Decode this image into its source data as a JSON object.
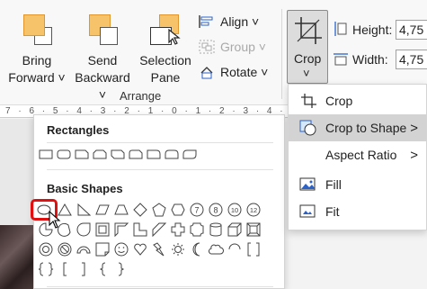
{
  "arrange": {
    "bring_forward": {
      "line1": "Bring",
      "line2": "Forward ˅"
    },
    "send_backward": {
      "line1": "Send",
      "line2": "Backward ˅"
    },
    "selection_pane": {
      "line1": "Selection",
      "line2": "Pane"
    },
    "align": "Align ˅",
    "group": "Group ˅",
    "rotate": "Rotate ˅",
    "group_label": "Arrange"
  },
  "crop_button": {
    "label": "Crop",
    "chevron": "˅"
  },
  "size": {
    "height_label": "Height:",
    "height_value": "4,75",
    "width_label": "Width:",
    "width_value": "4,75"
  },
  "ruler": {
    "text": "7 · 6 · 5 · 4 · 3 · 2 · 1 · 0 · 1 · 2 · 3 · 4 · 5"
  },
  "shapes_panel": {
    "rectangles_title": "Rectangles",
    "basic_shapes_title": "Basic Shapes",
    "octagon_numbers": [
      "7",
      "8",
      "10",
      "12"
    ]
  },
  "crop_menu": {
    "items": [
      {
        "label": "Crop",
        "icon": "crop-icon",
        "arrow": ""
      },
      {
        "label": "Crop to Shape",
        "icon": "crop-to-shape-icon",
        "arrow": ">"
      },
      {
        "label": "Aspect Ratio",
        "icon": "",
        "arrow": ">"
      },
      {
        "label": "Fill",
        "icon": "fill-image-icon",
        "arrow": ""
      },
      {
        "label": "Fit",
        "icon": "fit-image-icon",
        "arrow": ""
      }
    ]
  },
  "colors": {
    "accent_orange": "#f7c36a",
    "highlight": "#d3d3d3",
    "selection_red": "#e01010"
  }
}
